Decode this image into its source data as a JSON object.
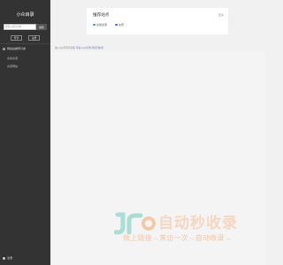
{
  "sidebar": {
    "title": "小众目录",
    "search": {
      "placeholder": "搜索心意的内容",
      "button_label": "搜索"
    },
    "buttons": [
      {
        "label": "登录"
      },
      {
        "label": "注册"
      }
    ],
    "section_label": "网站站推荐分类",
    "items": [
      {
        "label": "虚拟资源"
      },
      {
        "label": "资源网站"
      }
    ],
    "footer_label": "注册"
  },
  "card": {
    "title": "推荐站点",
    "more_label": "更多",
    "links": [
      {
        "label": "虚拟资源",
        "color": "#2aa59a",
        "icon": "site-icon"
      },
      {
        "label": "充值",
        "color": "#3a6fd8",
        "icon": "site-icon"
      }
    ]
  },
  "notice": {
    "prefix": "输入QQ号码可获取",
    "link": "可输入QQ号码并按回车键"
  },
  "watermark": {
    "logo": "JR",
    "title": "自动秒收录",
    "slogan": "做上链接→来访一次→自动收录→",
    "color": "#f5d7c1"
  },
  "colors": {
    "sidebar_bg": "#333333",
    "page_bg": "#f1f1f1",
    "card_bg": "#ffffff"
  }
}
